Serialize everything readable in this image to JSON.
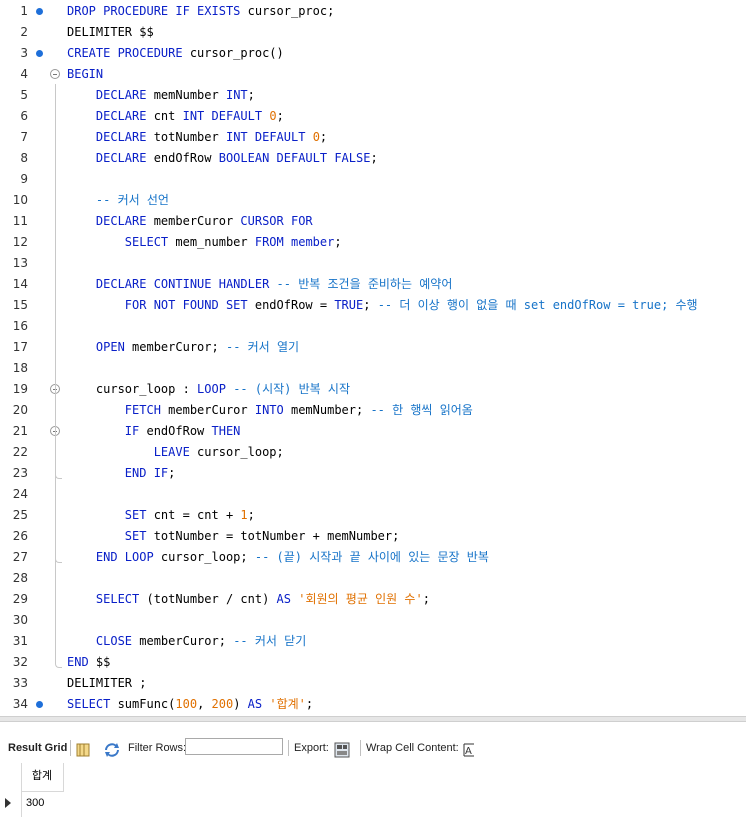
{
  "editor": {
    "lines": [
      {
        "n": "1",
        "marker": "dot",
        "tokens": [
          {
            "t": "DROP PROCEDURE IF EXISTS",
            "c": "kw"
          },
          {
            "t": " cursor_proc;",
            "c": ""
          }
        ]
      },
      {
        "n": "2",
        "marker": "",
        "tokens": [
          {
            "t": "DELIMITER $$",
            "c": ""
          }
        ]
      },
      {
        "n": "3",
        "marker": "dot",
        "tokens": [
          {
            "t": "CREATE PROCEDURE",
            "c": "kw"
          },
          {
            "t": " cursor_proc()",
            "c": ""
          }
        ]
      },
      {
        "n": "4",
        "marker": "fold",
        "tokens": [
          {
            "t": "BEGIN",
            "c": "kw"
          }
        ]
      },
      {
        "n": "5",
        "marker": "",
        "tokens": [
          {
            "t": "    ",
            "c": ""
          },
          {
            "t": "DECLARE",
            "c": "kw"
          },
          {
            "t": " memNumber ",
            "c": ""
          },
          {
            "t": "INT",
            "c": "kw"
          },
          {
            "t": ";",
            "c": ""
          }
        ]
      },
      {
        "n": "6",
        "marker": "",
        "tokens": [
          {
            "t": "    ",
            "c": ""
          },
          {
            "t": "DECLARE",
            "c": "kw"
          },
          {
            "t": " cnt ",
            "c": ""
          },
          {
            "t": "INT DEFAULT",
            "c": "kw"
          },
          {
            "t": " ",
            "c": ""
          },
          {
            "t": "0",
            "c": "num"
          },
          {
            "t": ";",
            "c": ""
          }
        ]
      },
      {
        "n": "7",
        "marker": "",
        "tokens": [
          {
            "t": "    ",
            "c": ""
          },
          {
            "t": "DECLARE",
            "c": "kw"
          },
          {
            "t": " totNumber ",
            "c": ""
          },
          {
            "t": "INT DEFAULT",
            "c": "kw"
          },
          {
            "t": " ",
            "c": ""
          },
          {
            "t": "0",
            "c": "num"
          },
          {
            "t": ";",
            "c": ""
          }
        ]
      },
      {
        "n": "8",
        "marker": "",
        "tokens": [
          {
            "t": "    ",
            "c": ""
          },
          {
            "t": "DECLARE",
            "c": "kw"
          },
          {
            "t": " endOfRow ",
            "c": ""
          },
          {
            "t": "BOOLEAN DEFAULT FALSE",
            "c": "kw"
          },
          {
            "t": ";",
            "c": ""
          }
        ]
      },
      {
        "n": "9",
        "marker": "",
        "tokens": []
      },
      {
        "n": "10",
        "marker": "",
        "tokens": [
          {
            "t": "    ",
            "c": ""
          },
          {
            "t": "-- 커서 선언",
            "c": "cm"
          }
        ]
      },
      {
        "n": "11",
        "marker": "",
        "tokens": [
          {
            "t": "    ",
            "c": ""
          },
          {
            "t": "DECLARE",
            "c": "kw"
          },
          {
            "t": " memberCuror ",
            "c": ""
          },
          {
            "t": "CURSOR FOR",
            "c": "kw"
          }
        ]
      },
      {
        "n": "12",
        "marker": "",
        "tokens": [
          {
            "t": "        ",
            "c": ""
          },
          {
            "t": "SELECT",
            "c": "kw"
          },
          {
            "t": " mem_number ",
            "c": ""
          },
          {
            "t": "FROM",
            "c": "kw"
          },
          {
            "t": " ",
            "c": ""
          },
          {
            "t": "member",
            "c": "kw"
          },
          {
            "t": ";",
            "c": ""
          }
        ]
      },
      {
        "n": "13",
        "marker": "",
        "tokens": []
      },
      {
        "n": "14",
        "marker": "",
        "tokens": [
          {
            "t": "    ",
            "c": ""
          },
          {
            "t": "DECLARE CONTINUE HANDLER",
            "c": "kw"
          },
          {
            "t": " ",
            "c": ""
          },
          {
            "t": "-- 반복 조건을 준비하는 예약어",
            "c": "cm"
          }
        ]
      },
      {
        "n": "15",
        "marker": "",
        "tokens": [
          {
            "t": "        ",
            "c": ""
          },
          {
            "t": "FOR NOT FOUND SET",
            "c": "kw"
          },
          {
            "t": " endOfRow = ",
            "c": ""
          },
          {
            "t": "TRUE",
            "c": "kw"
          },
          {
            "t": "; ",
            "c": ""
          },
          {
            "t": "-- 더 이상 행이 없을 때 set endOfRow = true; 수행",
            "c": "cm"
          }
        ]
      },
      {
        "n": "16",
        "marker": "",
        "tokens": []
      },
      {
        "n": "17",
        "marker": "",
        "tokens": [
          {
            "t": "    ",
            "c": ""
          },
          {
            "t": "OPEN",
            "c": "kw"
          },
          {
            "t": " memberCuror; ",
            "c": ""
          },
          {
            "t": "-- 커서 열기",
            "c": "cm"
          }
        ]
      },
      {
        "n": "18",
        "marker": "",
        "tokens": []
      },
      {
        "n": "19",
        "marker": "fold",
        "tokens": [
          {
            "t": "    cursor_loop : ",
            "c": ""
          },
          {
            "t": "LOOP",
            "c": "kw"
          },
          {
            "t": " ",
            "c": ""
          },
          {
            "t": "-- (시작) 반복 시작",
            "c": "cm"
          }
        ]
      },
      {
        "n": "20",
        "marker": "",
        "tokens": [
          {
            "t": "        ",
            "c": ""
          },
          {
            "t": "FETCH",
            "c": "kw"
          },
          {
            "t": " memberCuror ",
            "c": ""
          },
          {
            "t": "INTO",
            "c": "kw"
          },
          {
            "t": " memNumber; ",
            "c": ""
          },
          {
            "t": "-- 한 행씩 읽어옴",
            "c": "cm"
          }
        ]
      },
      {
        "n": "21",
        "marker": "fold",
        "tokens": [
          {
            "t": "        ",
            "c": ""
          },
          {
            "t": "IF",
            "c": "kw"
          },
          {
            "t": " endOfRow ",
            "c": ""
          },
          {
            "t": "THEN",
            "c": "kw"
          }
        ]
      },
      {
        "n": "22",
        "marker": "",
        "tokens": [
          {
            "t": "            ",
            "c": ""
          },
          {
            "t": "LEAVE",
            "c": "kw"
          },
          {
            "t": " cursor_loop;",
            "c": ""
          }
        ]
      },
      {
        "n": "23",
        "marker": "",
        "tokens": [
          {
            "t": "        ",
            "c": ""
          },
          {
            "t": "END IF",
            "c": "kw"
          },
          {
            "t": ";",
            "c": ""
          }
        ]
      },
      {
        "n": "24",
        "marker": "",
        "tokens": []
      },
      {
        "n": "25",
        "marker": "",
        "tokens": [
          {
            "t": "        ",
            "c": ""
          },
          {
            "t": "SET",
            "c": "kw"
          },
          {
            "t": " cnt = cnt + ",
            "c": ""
          },
          {
            "t": "1",
            "c": "num"
          },
          {
            "t": ";",
            "c": ""
          }
        ]
      },
      {
        "n": "26",
        "marker": "",
        "tokens": [
          {
            "t": "        ",
            "c": ""
          },
          {
            "t": "SET",
            "c": "kw"
          },
          {
            "t": " totNumber = totNumber + memNumber;",
            "c": ""
          }
        ]
      },
      {
        "n": "27",
        "marker": "",
        "tokens": [
          {
            "t": "    ",
            "c": ""
          },
          {
            "t": "END LOOP",
            "c": "kw"
          },
          {
            "t": " cursor_loop; ",
            "c": ""
          },
          {
            "t": "-- (끝) 시작과 끝 사이에 있는 문장 반복",
            "c": "cm"
          }
        ]
      },
      {
        "n": "28",
        "marker": "",
        "tokens": []
      },
      {
        "n": "29",
        "marker": "",
        "tokens": [
          {
            "t": "    ",
            "c": ""
          },
          {
            "t": "SELECT",
            "c": "kw"
          },
          {
            "t": " (totNumber / cnt) ",
            "c": ""
          },
          {
            "t": "AS",
            "c": "kw"
          },
          {
            "t": " ",
            "c": ""
          },
          {
            "t": "'회원의 평균 인원 수'",
            "c": "str"
          },
          {
            "t": ";",
            "c": ""
          }
        ]
      },
      {
        "n": "30",
        "marker": "",
        "tokens": []
      },
      {
        "n": "31",
        "marker": "",
        "tokens": [
          {
            "t": "    ",
            "c": ""
          },
          {
            "t": "CLOSE",
            "c": "kw"
          },
          {
            "t": " memberCuror; ",
            "c": ""
          },
          {
            "t": "-- 커서 닫기",
            "c": "cm"
          }
        ]
      },
      {
        "n": "32",
        "marker": "",
        "tokens": [
          {
            "t": "END",
            "c": "kw"
          },
          {
            "t": " $$",
            "c": ""
          }
        ]
      },
      {
        "n": "33",
        "marker": "",
        "tokens": [
          {
            "t": "DELIMITER ;",
            "c": ""
          }
        ]
      },
      {
        "n": "34",
        "marker": "dot",
        "tokens": [
          {
            "t": "SELECT",
            "c": "kw"
          },
          {
            "t": " sumFunc(",
            "c": ""
          },
          {
            "t": "100",
            "c": "num"
          },
          {
            "t": ", ",
            "c": ""
          },
          {
            "t": "200",
            "c": "num"
          },
          {
            "t": ") ",
            "c": ""
          },
          {
            "t": "AS",
            "c": "kw"
          },
          {
            "t": " ",
            "c": ""
          },
          {
            "t": "'합계'",
            "c": "str"
          },
          {
            "t": ";",
            "c": ""
          }
        ]
      }
    ]
  },
  "toolbar": {
    "result_grid_label": "Result Grid",
    "filter_rows_label": "Filter Rows:",
    "filter_rows_value": "",
    "export_label": "Export:",
    "wrap_label": "Wrap Cell Content:"
  },
  "grid": {
    "columns": [
      "합계"
    ],
    "rows": [
      [
        "300"
      ]
    ]
  },
  "colors": {
    "keyword": "#0a20c8",
    "comment": "#1673c8",
    "number": "#e07000",
    "string": "#e07000",
    "marker": "#1e6fd9"
  }
}
